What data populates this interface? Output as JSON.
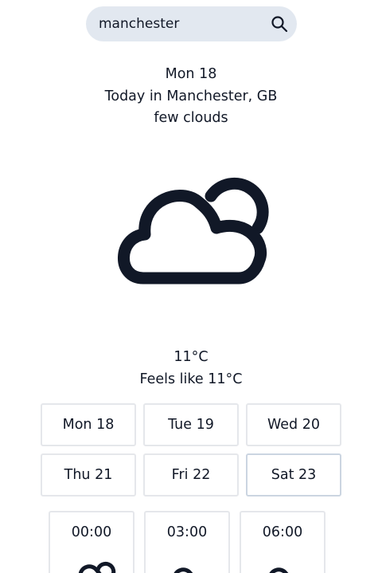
{
  "search": {
    "value": "manchester",
    "icon": "search-icon"
  },
  "current": {
    "date": "Mon 18",
    "location": "Today in Manchester, GB",
    "description": "few clouds",
    "icon": "cloud-moon-icon",
    "temperature": "11°C",
    "feels_like": "Feels like 11°C"
  },
  "days": [
    "Mon 18",
    "Tue 19",
    "Wed 20",
    "Thu 21",
    "Fri 22",
    "Sat 23"
  ],
  "hourly": [
    {
      "time": "00:00",
      "icon": "cloud-moon-icon"
    },
    {
      "time": "03:00",
      "icon": "cloud-icon"
    },
    {
      "time": "06:00",
      "icon": "cloud-icon"
    }
  ],
  "colors": {
    "icon": "#111827",
    "search_bg": "#e2e8f0",
    "card_border": "#e5e7eb"
  }
}
